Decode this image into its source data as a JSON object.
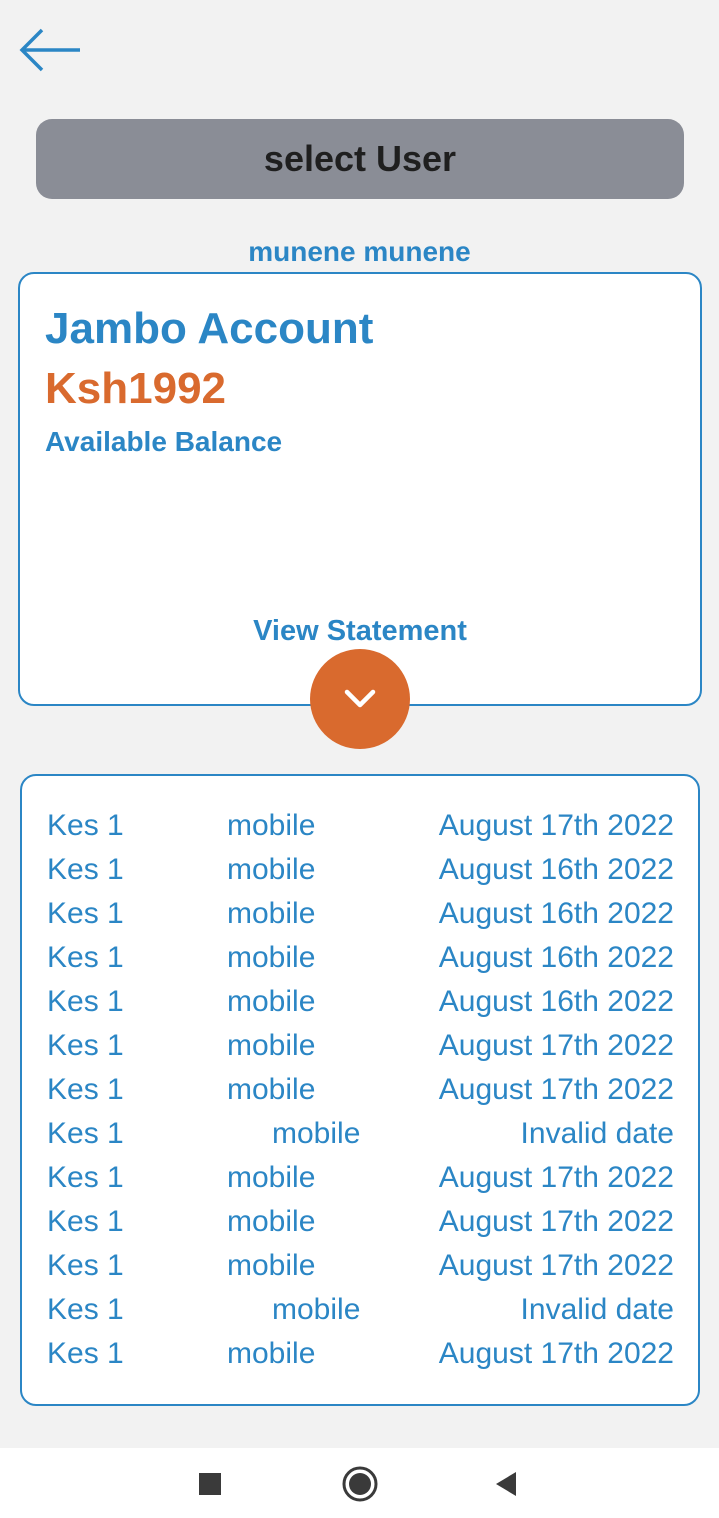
{
  "header": {
    "back_icon": "arrow-left-icon"
  },
  "select_user": {
    "label": "select User"
  },
  "user": {
    "name": "munene munene"
  },
  "account": {
    "title": "Jambo Account",
    "balance": "Ksh1992",
    "balance_label": "Available Balance",
    "view_statement_label": "View Statement",
    "expand_icon": "chevron-down-icon"
  },
  "statement": {
    "rows": [
      {
        "amount": "Kes 1",
        "channel": "mobile",
        "date": "August 17th 2022"
      },
      {
        "amount": "Kes 1",
        "channel": "mobile",
        "date": "August 16th 2022"
      },
      {
        "amount": "Kes 1",
        "channel": "mobile",
        "date": "August 16th 2022"
      },
      {
        "amount": "Kes 1",
        "channel": "mobile",
        "date": "August 16th 2022"
      },
      {
        "amount": "Kes 1",
        "channel": "mobile",
        "date": "August 16th 2022"
      },
      {
        "amount": "Kes 1",
        "channel": "mobile",
        "date": "August 17th 2022"
      },
      {
        "amount": "Kes 1",
        "channel": "mobile",
        "date": "August 17th 2022"
      },
      {
        "amount": "Kes 1",
        "channel": "mobile",
        "date": "Invalid date"
      },
      {
        "amount": "Kes 1",
        "channel": "mobile",
        "date": "August 17th 2022"
      },
      {
        "amount": "Kes 1",
        "channel": "mobile",
        "date": "August 17th 2022"
      },
      {
        "amount": "Kes 1",
        "channel": "mobile",
        "date": "August 17th 2022"
      },
      {
        "amount": "Kes 1",
        "channel": "mobile",
        "date": "Invalid date"
      },
      {
        "amount": "Kes 1",
        "channel": "mobile",
        "date": "August 17th 2022"
      }
    ]
  },
  "system_nav": {
    "recents_icon": "square-icon",
    "home_icon": "circle-icon",
    "back_icon": "triangle-back-icon"
  },
  "colors": {
    "primary_blue": "#2b86c5",
    "accent_orange": "#d96a2e",
    "button_gray": "#8a8d96",
    "background": "#f2f2f2"
  }
}
